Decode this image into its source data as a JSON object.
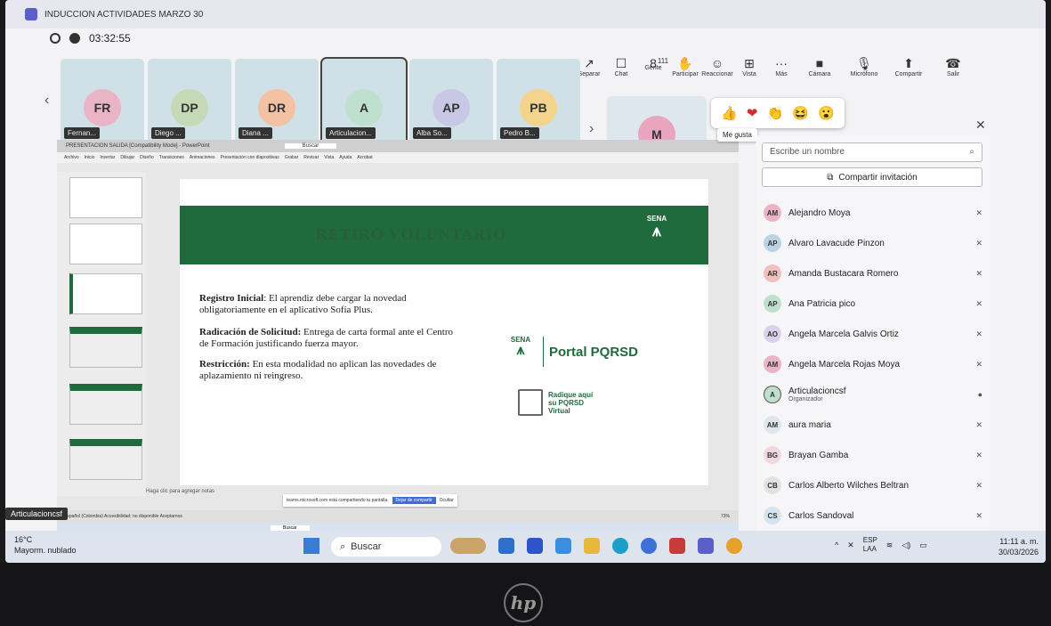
{
  "window": {
    "title": "INDUCCION ACTIVIDADES MARZO 30",
    "timer": "03:32:55"
  },
  "toolbar": [
    {
      "label": "Separar",
      "icon": "↗"
    },
    {
      "label": "Chat",
      "icon": "☐"
    },
    {
      "label": "Gente",
      "icon": "8",
      "count": "111"
    },
    {
      "label": "Participar",
      "icon": "✋"
    },
    {
      "label": "Reaccionar",
      "icon": "☺"
    },
    {
      "label": "Vista",
      "icon": "⊞"
    },
    {
      "label": "Más",
      "icon": "···"
    },
    {
      "label": "Cámara",
      "icon": "■"
    },
    {
      "label": "Micrófono",
      "icon": "🎙"
    },
    {
      "label": "Compartir",
      "icon": "⬆"
    },
    {
      "label": "Salir",
      "icon": "☎"
    }
  ],
  "tiles": [
    {
      "initials": "FR",
      "name": "Fernan...",
      "color": "#e9b4c5"
    },
    {
      "initials": "DP",
      "name": "Diego ...",
      "color": "#c6d9b7"
    },
    {
      "initials": "DR",
      "name": "Diana ...",
      "color": "#f3c2a4"
    },
    {
      "initials": "A",
      "name": "Articulacion...",
      "color": "#bfe0cf"
    },
    {
      "initials": "AP",
      "name": "Alba So...",
      "color": "#c9c7e6"
    },
    {
      "initials": "PB",
      "name": "Pedro B...",
      "color": "#f4d38c"
    }
  ],
  "big_tile": {
    "initials": "M",
    "color": "#e9a5bd"
  },
  "reactions": {
    "emojis": [
      "👍",
      "❤",
      "👏",
      "😆",
      "😮"
    ],
    "tooltip": "Me gusta"
  },
  "powerpoint": {
    "window_title": "PRESENTACION SALIDA [Compatibility Mode] - PowerPoint",
    "tabs": [
      "Archivo",
      "Inicio",
      "Insertar",
      "Dibujar",
      "Diseño",
      "Transiciones",
      "Animaciones",
      "Presentación con diapositivas",
      "Grabar",
      "Revisar",
      "Vista",
      "Ayuda",
      "Acrobat"
    ],
    "search": "Buscar",
    "notes_hint": "Haga clic para agregar notas",
    "share_notice": "teams.microsoft.com está compartiendo tu pantalla.",
    "stop_share": "Dejar de compartir",
    "hide": "Ocultar",
    "status": "Español (Colombia)   Accesibilidad: no disponible   Aceptarnos",
    "zoom": "73%"
  },
  "slide": {
    "title": "RETIRO VOLUNTARIO",
    "logo": "SENA",
    "items": [
      {
        "heading": "Registro Inicial",
        "text": ": El aprendiz debe cargar la novedad obligatoriamente en el aplicativo Sofía Plus."
      },
      {
        "heading": "Radicación de Solicitud:",
        "text": " Entrega de carta formal ante el Centro de Formación justificando fuerza mayor."
      },
      {
        "heading": "Restricción:",
        "text": " En esta modalidad no aplican las novedades de aplazamiento ni reingreso."
      }
    ],
    "portal": "Portal PQRSD",
    "radique": [
      "Radique aquí",
      "su PQRSD",
      "Virtual"
    ]
  },
  "presenter": "Articulacioncsf",
  "people": {
    "search_placeholder": "Escribe un nombre",
    "invite": "Compartir invitación",
    "list": [
      {
        "initials": "AM",
        "name": "Alejandro Moya",
        "color": "#e9b4c5"
      },
      {
        "initials": "AP",
        "name": "Alvaro Lavacude Pinzon",
        "color": "#bcd3e6"
      },
      {
        "initials": "AR",
        "name": "Amanda Bustacara Romero",
        "color": "#f0bfc0"
      },
      {
        "initials": "AP",
        "name": "Ana Patricia pico",
        "color": "#bfe0cf"
      },
      {
        "initials": "AO",
        "name": "Angela Marcela Galvis Ortiz",
        "color": "#d8d2ea"
      },
      {
        "initials": "AM",
        "name": "Angela Marcela Rojas Moya",
        "color": "#e9b4c5"
      },
      {
        "initials": "A",
        "name": "Articulacioncsf",
        "sub": "Organizador",
        "color": "#bfe0cf"
      },
      {
        "initials": "AM",
        "name": "aura maria",
        "color": "#dfe6ee"
      },
      {
        "initials": "BG",
        "name": "Brayan Gamba",
        "color": "#f0d7e0"
      },
      {
        "initials": "CB",
        "name": "Carlos Alberto Wilches Beltran",
        "color": "#e2e2e2"
      },
      {
        "initials": "CS",
        "name": "Carlos Sandoval",
        "color": "#d5e4ef"
      }
    ]
  },
  "taskbar": {
    "weather_temp": "16°C",
    "weather_desc": "Mayorm. nublado",
    "search": "Buscar",
    "lang": "ESP",
    "lang2": "LAA",
    "time": "11:11 a. m.",
    "date": "30/03/2026"
  },
  "brand": "hp"
}
